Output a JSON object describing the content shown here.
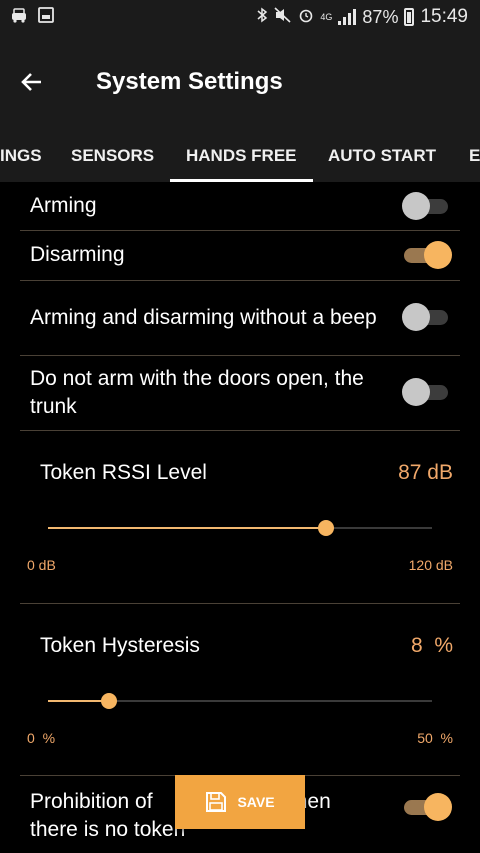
{
  "status_bar": {
    "battery": "87%",
    "time": "15:49",
    "network": "4G"
  },
  "app_bar": {
    "title": "System Settings"
  },
  "tabs": [
    {
      "label": "INGS",
      "active": false
    },
    {
      "label": "SENSORS",
      "active": false
    },
    {
      "label": "HANDS FREE",
      "active": true
    },
    {
      "label": "AUTO START",
      "active": false
    },
    {
      "label": "E",
      "active": false
    }
  ],
  "settings": [
    {
      "label": "Arming",
      "enabled": false
    },
    {
      "label": "Disarming",
      "enabled": true
    },
    {
      "label": "Arming and disarming without a beep",
      "enabled": false
    },
    {
      "label": "Do not arm with the doors open, the trunk",
      "enabled": false
    }
  ],
  "sliders": [
    {
      "label": "Token RSSI Level",
      "value_text": "87 dB",
      "value": 87,
      "min": 0,
      "max": 120,
      "min_label": "0 dB",
      "max_label": "120 dB"
    },
    {
      "label": "Token Hysteresis",
      "value_text": "8  %",
      "value": 8,
      "min": 0,
      "max": 50,
      "min_label": "0  %",
      "max_label": "50  %"
    }
  ],
  "last_setting": {
    "label_part1": "Prohibition of",
    "label_part2": "when",
    "label_line2": "there is no token",
    "enabled": true
  },
  "save_button": {
    "label": "SAVE"
  },
  "colors": {
    "accent": "#f2a541",
    "value_text": "#f0a86a",
    "background": "#000000",
    "bar": "#1b1b1b"
  }
}
